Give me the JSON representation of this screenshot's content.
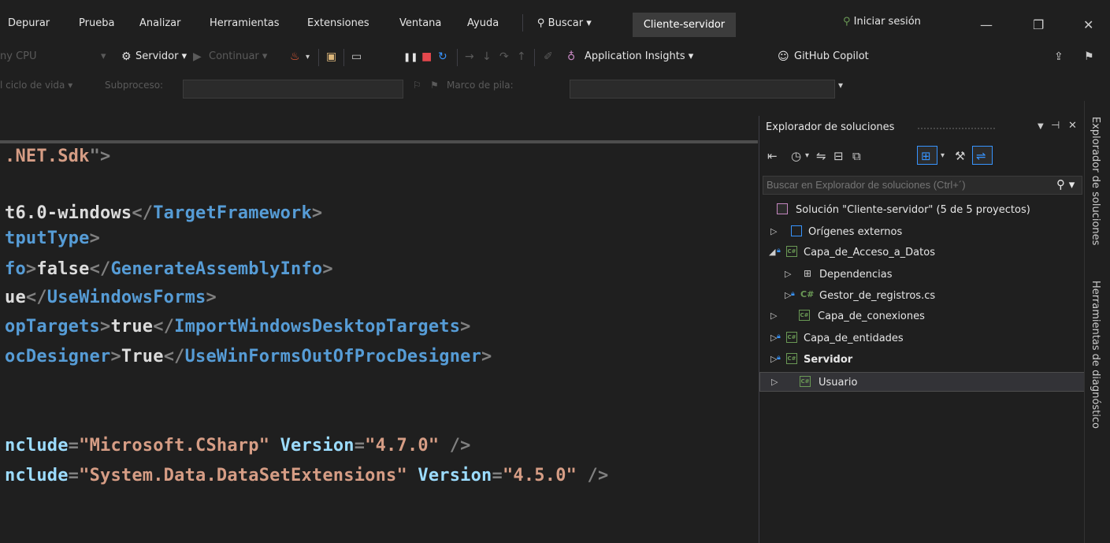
{
  "menu": {
    "items": [
      "Depurar",
      "Prueba",
      "Analizar",
      "Herramientas",
      "Extensiones",
      "Ventana",
      "Ayuda"
    ],
    "search_label": "Buscar ▾",
    "solution_name": "Cliente-servidor",
    "signin_label": "Iniciar sesión",
    "minimize": "—",
    "restore": "❐",
    "close": "✕"
  },
  "toolbar": {
    "platform": "ny CPU",
    "startup_project": "Servidor ▾",
    "continue": "Continuar ▾",
    "app_insights": "Application Insights ▾",
    "copilot": "GitHub Copilot"
  },
  "debugbar": {
    "lifecycle": "l ciclo de vida ▾",
    "thread_label": "Subproceso:",
    "stack_label": "Marco de pila:"
  },
  "editor": {
    "lines": [
      {
        "parts": [
          {
            "t": ".NET.Sdk",
            "c": "c-str"
          },
          {
            "t": "\">",
            "c": "c-punc"
          }
        ]
      },
      {
        "parts": [
          {
            "t": "t6.0-windows",
            "c": "c-txt"
          },
          {
            "t": "</",
            "c": "c-punc"
          },
          {
            "t": "TargetFramework",
            "c": "c-tag"
          },
          {
            "t": ">",
            "c": "c-punc"
          }
        ]
      },
      {
        "parts": [
          {
            "t": "tputType",
            "c": "c-tag"
          },
          {
            "t": ">",
            "c": "c-punc"
          }
        ]
      },
      {
        "parts": [
          {
            "t": "fo",
            "c": "c-tag"
          },
          {
            "t": ">",
            "c": "c-punc"
          },
          {
            "t": "false",
            "c": "c-txt"
          },
          {
            "t": "</",
            "c": "c-punc"
          },
          {
            "t": "GenerateAssemblyInfo",
            "c": "c-tag"
          },
          {
            "t": ">",
            "c": "c-punc"
          }
        ]
      },
      {
        "parts": [
          {
            "t": "ue",
            "c": "c-txt"
          },
          {
            "t": "</",
            "c": "c-punc"
          },
          {
            "t": "UseWindowsForms",
            "c": "c-tag"
          },
          {
            "t": ">",
            "c": "c-punc"
          }
        ]
      },
      {
        "parts": [
          {
            "t": "opTargets",
            "c": "c-tag"
          },
          {
            "t": ">",
            "c": "c-punc"
          },
          {
            "t": "true",
            "c": "c-txt"
          },
          {
            "t": "</",
            "c": "c-punc"
          },
          {
            "t": "ImportWindowsDesktopTargets",
            "c": "c-tag"
          },
          {
            "t": ">",
            "c": "c-punc"
          }
        ]
      },
      {
        "parts": [
          {
            "t": "ocDesigner",
            "c": "c-tag"
          },
          {
            "t": ">",
            "c": "c-punc"
          },
          {
            "t": "True",
            "c": "c-txt"
          },
          {
            "t": "</",
            "c": "c-punc"
          },
          {
            "t": "UseWinFormsOutOfProcDesigner",
            "c": "c-tag"
          },
          {
            "t": ">",
            "c": "c-punc"
          }
        ]
      },
      {
        "parts": [
          {
            "t": "nclude",
            "c": "c-attr"
          },
          {
            "t": "=",
            "c": "c-punc"
          },
          {
            "t": "\"Microsoft.CSharp\"",
            "c": "c-str"
          },
          {
            "t": " ",
            "c": "c-txt"
          },
          {
            "t": "Version",
            "c": "c-attr"
          },
          {
            "t": "=",
            "c": "c-punc"
          },
          {
            "t": "\"4.7.0\"",
            "c": "c-str"
          },
          {
            "t": " />",
            "c": "c-punc"
          }
        ]
      },
      {
        "parts": [
          {
            "t": "nclude",
            "c": "c-attr"
          },
          {
            "t": "=",
            "c": "c-punc"
          },
          {
            "t": "\"System.Data.DataSetExtensions\"",
            "c": "c-str"
          },
          {
            "t": " ",
            "c": "c-txt"
          },
          {
            "t": "Version",
            "c": "c-attr"
          },
          {
            "t": "=",
            "c": "c-punc"
          },
          {
            "t": "\"4.5.0\"",
            "c": "c-str"
          },
          {
            "t": " />",
            "c": "c-punc"
          }
        ]
      }
    ]
  },
  "solution_explorer": {
    "title": "Explorador de soluciones",
    "search_placeholder": "Buscar en Explorador de soluciones (Ctrl+´)",
    "tree": [
      {
        "label": "Solución \"Cliente-servidor\"  (5 de 5 proyectos)",
        "bold": false,
        "icon": "solution-icon"
      },
      {
        "label": "Orígenes externos",
        "bold": false,
        "icon": "external-sources-icon"
      },
      {
        "label": "Capa_de_Acceso_a_Datos",
        "bold": false,
        "icon": "csharp-project-icon"
      },
      {
        "label": "Dependencias",
        "bold": false,
        "icon": "dependencies-icon"
      },
      {
        "label": "Gestor_de_registros.cs",
        "bold": false,
        "icon": "csharp-file-icon"
      },
      {
        "label": "Capa_de_conexiones",
        "bold": false,
        "icon": "csharp-project-icon"
      },
      {
        "label": "Capa_de_entidades",
        "bold": false,
        "icon": "csharp-project-icon"
      },
      {
        "label": "Servidor",
        "bold": true,
        "icon": "csharp-project-icon"
      },
      {
        "label": "Usuario",
        "bold": false,
        "icon": "csharp-project-icon"
      }
    ]
  },
  "side_tabs": {
    "solution_explorer": "Explorador de soluciones",
    "diagnostic_tools": "Herramientas de diagnóstico"
  },
  "colors": {
    "accent": "#3794ff",
    "csharp": "#6a9955",
    "tag": "#569cd6",
    "string": "#d69d85",
    "attribute": "#9cdcfe"
  }
}
